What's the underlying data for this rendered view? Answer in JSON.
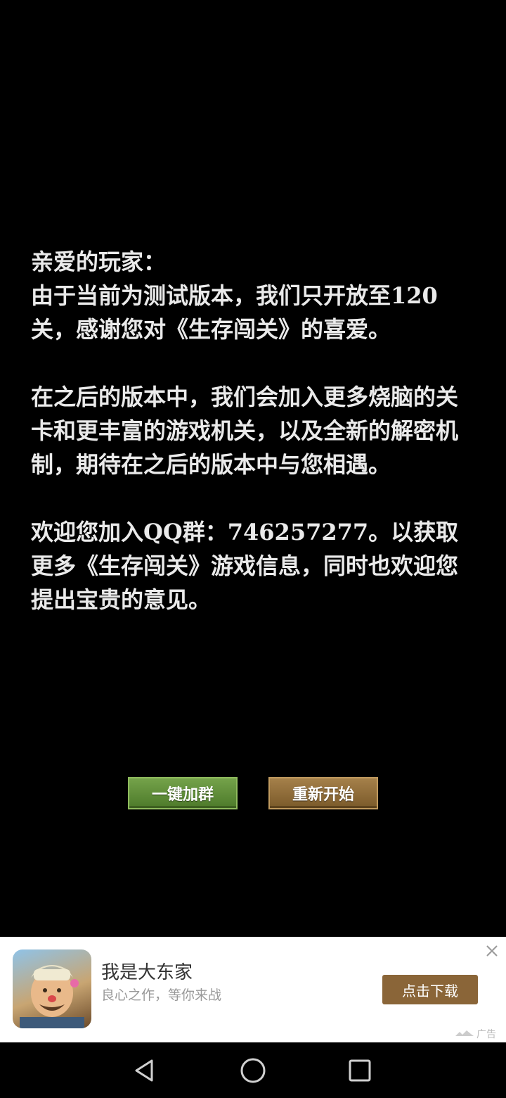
{
  "notice": {
    "greeting": "亲爱的玩家：",
    "paragraph1": "由于当前为测试版本，我们只开放至120关，感谢您对《生存闯关》的喜爱。",
    "paragraph2": "在之后的版本中，我们会加入更多烧脑的关卡和更丰富的游戏机关，以及全新的解密机制，期待在之后的版本中与您相遇。",
    "paragraph3": "欢迎您加入QQ群：746257277。以获取更多《生存闯关》游戏信息，同时也欢迎您提出宝贵的意见。"
  },
  "buttons": {
    "join_group": "一键加群",
    "restart": "重新开始"
  },
  "ad": {
    "title": "我是大东家",
    "subtitle": "良心之作，等你来战",
    "download_label": "点击下载",
    "ad_label": "广告"
  },
  "navbar": {
    "back_icon": "back-triangle-icon",
    "home_icon": "home-circle-icon",
    "recents_icon": "recents-square-icon"
  },
  "colors": {
    "background": "#000000",
    "join_button": "#5f8c38",
    "restart_button": "#8f6d3a",
    "ad_download_button": "#8a6538"
  }
}
